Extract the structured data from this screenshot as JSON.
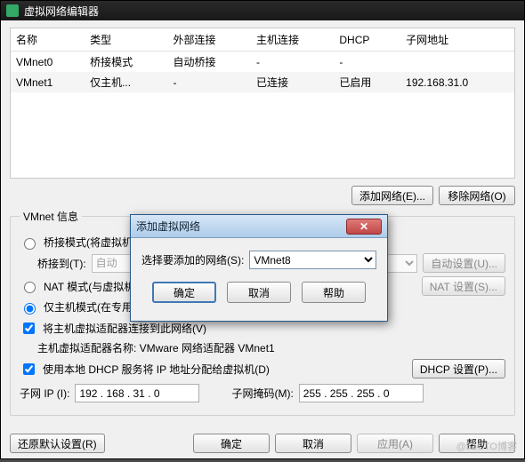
{
  "window": {
    "title": "虚拟网络编辑器"
  },
  "table": {
    "headers": [
      "名称",
      "类型",
      "外部连接",
      "主机连接",
      "DHCP",
      "子网地址"
    ],
    "rows": [
      {
        "name": "VMnet0",
        "type": "桥接模式",
        "ext": "自动桥接",
        "host": "-",
        "dhcp": "-",
        "subnet": ""
      },
      {
        "name": "VMnet1",
        "type": "仅主机...",
        "ext": "-",
        "host": "已连接",
        "dhcp": "已启用",
        "subnet": "192.168.31.0"
      }
    ],
    "add_btn": "添加网络(E)...",
    "remove_btn": "移除网络(O)"
  },
  "vmnet_info": {
    "legend": "VMnet 信息",
    "bridge_radio": "桥接模式(将虚拟机直接连接到外部网络)(B)",
    "bridge_to_label": "桥接到(T):",
    "bridge_to_value": "自动",
    "auto_settings_btn": "自动设置(U)...",
    "nat_radio": "NAT 模式(与虚拟机共享主机的 IP 地址)(N)",
    "nat_settings_btn": "NAT 设置(S)...",
    "hostonly_radio": "仅主机模式(在专用网络内连接虚拟机)(H)",
    "connect_host_check": "将主机虚拟适配器连接到此网络(V)",
    "host_adapter_label": "主机虚拟适配器名称: VMware 网络适配器 VMnet1",
    "use_dhcp_check": "使用本地 DHCP 服务将 IP 地址分配给虚拟机(D)",
    "dhcp_settings_btn": "DHCP 设置(P)...",
    "subnet_ip_label": "子网 IP (I):",
    "subnet_ip": "192 . 168 .  31  .  0",
    "subnet_mask_label": "子网掩码(M):",
    "subnet_mask": "255 . 255 . 255 .  0"
  },
  "footer": {
    "restore_defaults": "还原默认设置(R)",
    "ok": "确定",
    "cancel": "取消",
    "apply": "应用(A)",
    "help": "帮助"
  },
  "modal": {
    "title": "添加虚拟网络",
    "select_label": "选择要添加的网络(S):",
    "select_value": "VMnet8",
    "ok": "确定",
    "cancel": "取消",
    "help": "帮助"
  },
  "watermark": "@51CTO博客"
}
